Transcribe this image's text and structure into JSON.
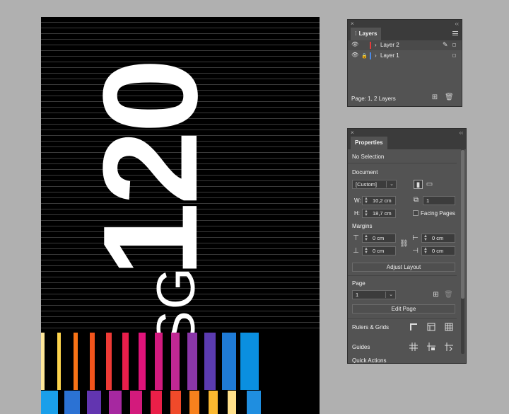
{
  "artwork": {
    "number_text": "120",
    "letters_text": "SG",
    "stripe_colors_top": [
      "#ffe79a",
      "#000",
      "#fcd34d",
      "#000",
      "#f97316",
      "#000",
      "#f2541b",
      "#000",
      "#ee3a36",
      "#000",
      "#e81e4a",
      "#000",
      "#e0137a",
      "#000",
      "#d21a7e",
      "#000",
      "#c02893",
      "#000",
      "#8a36a8",
      "#000",
      "#5b3bb0",
      "#000",
      "#1f7bd6",
      "#000",
      "#0a8fe0"
    ],
    "stripe_colors_bottom": [
      "#1a9fea",
      "#000",
      "#2b72d4",
      "#000",
      "#6235b0",
      "#000",
      "#a628a0",
      "#000",
      "#d31a7c",
      "#000",
      "#ea1f48",
      "#000",
      "#f04a2a",
      "#000",
      "#f7811d",
      "#000",
      "#fbb830",
      "#000",
      "#ffe08a",
      "#000",
      "#1f8ee0"
    ]
  },
  "layers_panel": {
    "close_glyph": "×",
    "collapse_glyph": "‹‹",
    "tab_label": "Layers",
    "layers": [
      {
        "name": "Layer 2",
        "color": "#e53b3b",
        "locked": false
      },
      {
        "name": "Layer 1",
        "color": "#4b8be8",
        "locked": true
      }
    ],
    "status": "Page: 1, 2 Layers"
  },
  "properties_panel": {
    "close_glyph": "×",
    "collapse_glyph": "‹‹",
    "tab_label": "Properties",
    "selection": "No Selection",
    "document_section": "Document",
    "preset_value": "[Custom]",
    "width_label": "W:",
    "width_value": "10,2 cm",
    "height_label": "H:",
    "height_value": "18,7 cm",
    "pages_value": "1",
    "facing_pages_label": "Facing Pages",
    "margins_section": "Margins",
    "margin_top": "0 cm",
    "margin_bottom": "0 cm",
    "margin_left": "0 cm",
    "margin_right": "0 cm",
    "adjust_layout_label": "Adjust Layout",
    "page_section": "Page",
    "page_value": "1",
    "edit_page_label": "Edit Page",
    "rulers_grids_label": "Rulers & Grids",
    "guides_label": "Guides",
    "quick_actions_label": "Quick Actions"
  }
}
